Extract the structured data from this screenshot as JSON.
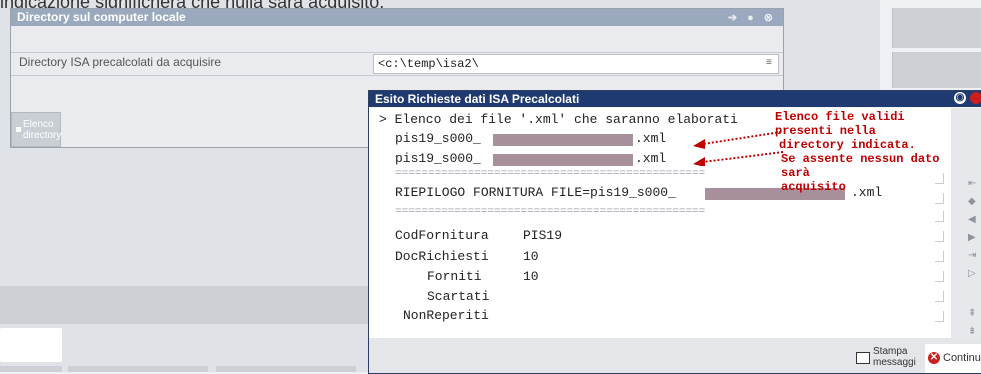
{
  "caption": "indicazione significherà che nulla sarà acquisito.",
  "local_window": {
    "title": "Directory sul computer locale",
    "field_label": "Directory ISA precalcolati da acquisire",
    "field_value": "<c:\\temp\\isa2\\",
    "elenco_button": [
      "Elenco",
      "directory"
    ]
  },
  "result_window": {
    "title": "Esito Richieste dati ISA Precalcolati",
    "lines": {
      "intro": "> Elenco dei file '.xml' che saranno elaborati",
      "file1_prefix": "pis19_s000_",
      "file1_suffix": ".xml",
      "file2_prefix": "pis19_s000_",
      "file2_suffix": ".xml",
      "separator": "===============================================",
      "riepilogo_prefix": "RIEPILOGO FORNITURA FILE=pis19_s000_",
      "riepilogo_suffix": ".xml",
      "separator2": "===============================================",
      "cod_label": "CodFornitura",
      "cod_value": "PIS19",
      "doc_label": "DocRichiesti",
      "doc_value": "10",
      "forniti_label": "Forniti",
      "forniti_value": "10",
      "scartati_label": "Scartati",
      "nonrep_label": "NonReperiti"
    },
    "annotation": [
      "Elenco file validi presenti nella",
      "directory indicata.",
      "Se assente nessun dato sarà",
      "acquisito"
    ],
    "buttons": {
      "stampa": [
        "Stampa",
        "messaggi"
      ],
      "continua": "Continua"
    }
  },
  "colors": {
    "title_bar_dark": "#1f3a70",
    "title_bar_light": "#9aa9bd",
    "annotation_red": "#c00000",
    "redaction": "#a88f9c"
  }
}
